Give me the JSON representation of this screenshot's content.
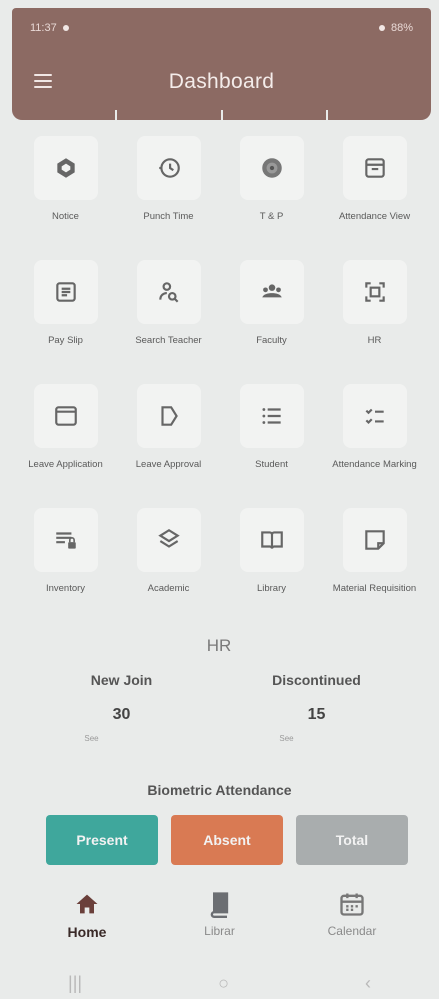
{
  "status_bar": {
    "time": "11:37",
    "battery": "88%"
  },
  "header": {
    "title": "Dashboard"
  },
  "tiles": [
    {
      "label": "Notice",
      "icon": "hexagon-icon"
    },
    {
      "label": "Punch Time",
      "icon": "history-clock-icon"
    },
    {
      "label": "T & P",
      "icon": "target-icon"
    },
    {
      "label": "Attendance View",
      "icon": "archive-icon"
    },
    {
      "label": "Pay Slip",
      "icon": "payslip-icon"
    },
    {
      "label": "Search Teacher",
      "icon": "search-person-icon"
    },
    {
      "label": "Faculty",
      "icon": "group-icon"
    },
    {
      "label": "HR",
      "icon": "scan-frame-icon"
    },
    {
      "label": "Leave Application",
      "icon": "window-icon"
    },
    {
      "label": "Leave Approval",
      "icon": "tag-icon"
    },
    {
      "label": "Student",
      "icon": "list-icon"
    },
    {
      "label": "Attendance Marking",
      "icon": "checklist-icon"
    },
    {
      "label": "Inventory",
      "icon": "inventory-icon"
    },
    {
      "label": "Academic",
      "icon": "layers-icon"
    },
    {
      "label": "Library",
      "icon": "book-icon"
    },
    {
      "label": "Material Requisition",
      "icon": "note-icon"
    }
  ],
  "hr_summary": {
    "title": "HR",
    "new_join": {
      "label": "New Join",
      "value": "30",
      "sub": "See"
    },
    "discontinued": {
      "label": "Discontinued",
      "value": "15",
      "sub": "See"
    }
  },
  "biometric": {
    "title": "Biometric Attendance",
    "buttons": {
      "present": "Present",
      "absent": "Absent",
      "total": "Total"
    },
    "colors": {
      "present": "#3fa79c",
      "absent": "#d97a53",
      "total": "#a9adae"
    }
  },
  "bottom_nav": {
    "home": "Home",
    "library": "Librar",
    "calendar": "Calendar"
  },
  "system_nav": {
    "recent": "|||",
    "home": "○",
    "back": "‹"
  },
  "colors": {
    "header": "#8c6a63",
    "background": "#e9ebea"
  }
}
